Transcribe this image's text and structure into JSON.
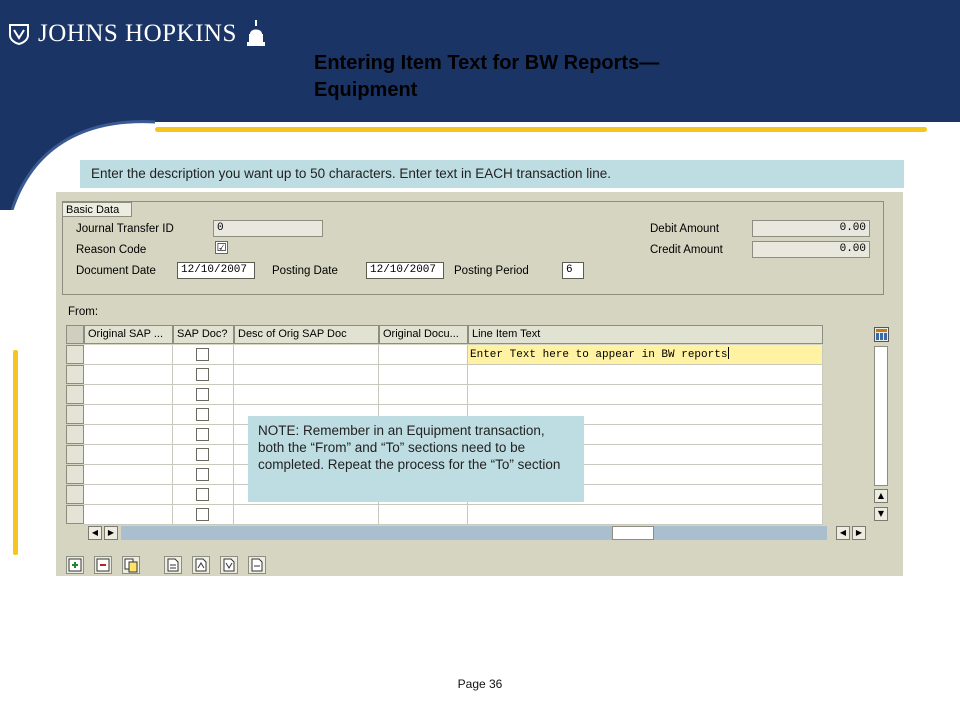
{
  "brand": {
    "name": "JOHNS HOPKINS",
    "shield_icon": "shield-icon",
    "dome_icon": "dome-icon"
  },
  "slide": {
    "title": "Entering Item Text for BW Reports—Equipment",
    "instruction": "Enter the description you want up to 50 characters. Enter text in EACH transaction line.",
    "note": "NOTE: Remember in an Equipment transaction, both the “From” and “To” sections need to be completed. Repeat the process for the “To” section",
    "page": "Page 36"
  },
  "colors": {
    "navy": "#1b3466",
    "gold": "#f4c61e",
    "callout": "#bedde2",
    "sap_bg": "#d5d5c1",
    "active_cell": "#fff3a3"
  },
  "basic_data": {
    "label": "Basic Data",
    "journal_transfer_id": {
      "label": "Journal Transfer ID",
      "value": "0"
    },
    "reason_code": {
      "label": "Reason Code",
      "checked_glyph": "☑"
    },
    "document_date": {
      "label": "Document Date",
      "value": "12/10/2007"
    },
    "posting_date": {
      "label": "Posting Date",
      "value": "12/10/2007"
    },
    "posting_period": {
      "label": "Posting Period",
      "value": "6"
    },
    "debit_amount": {
      "label": "Debit Amount",
      "value": "0.00"
    },
    "credit_amount": {
      "label": "Credit Amount",
      "value": "0.00"
    }
  },
  "from_section": {
    "label": "From:",
    "columns": [
      "Original SAP ...",
      "SAP Doc?",
      "Desc of Orig SAP Doc",
      "Original Docu...",
      "Line Item Text"
    ],
    "rows": [
      {
        "line_item_text": "Enter Text here to appear in BW reports"
      },
      {
        "line_item_text": ""
      },
      {
        "line_item_text": ""
      },
      {
        "line_item_text": ""
      },
      {
        "line_item_text": ""
      },
      {
        "line_item_text": ""
      },
      {
        "line_item_text": ""
      },
      {
        "line_item_text": ""
      },
      {
        "line_item_text": ""
      }
    ]
  },
  "toolbar_icons": [
    "insert-row-icon",
    "delete-row-icon",
    "copy-row-icon",
    "document-icon-1",
    "document-icon-2",
    "document-icon-3",
    "document-icon-4"
  ]
}
